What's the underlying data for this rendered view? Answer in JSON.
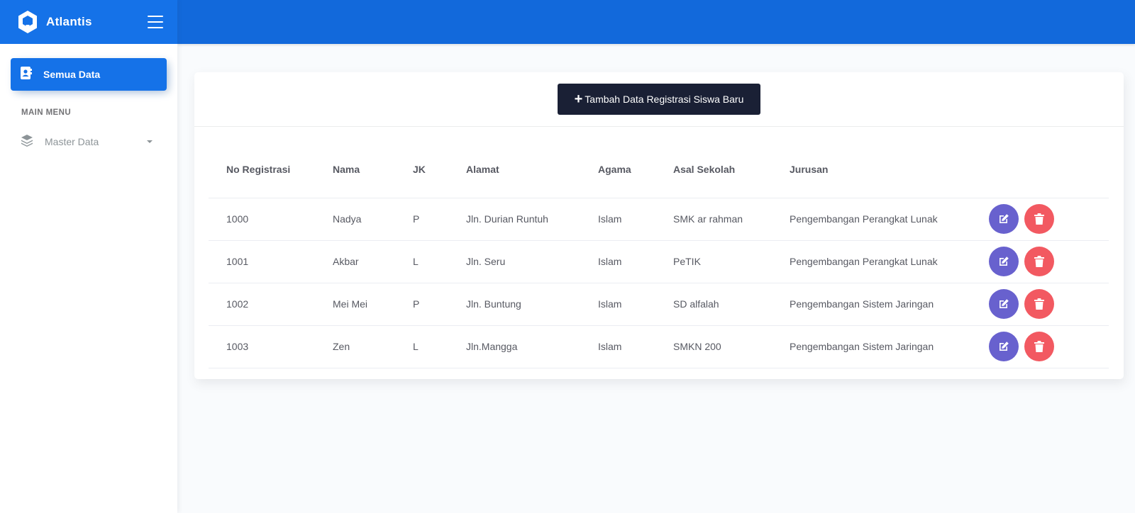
{
  "app": {
    "brand": "Atlantis"
  },
  "sidebar": {
    "active_item": {
      "label": "Semua Data",
      "icon": "contact-card-icon"
    },
    "section_title": "MAIN MENU",
    "items": [
      {
        "label": "Master Data",
        "icon": "layers-icon"
      }
    ]
  },
  "toolbar": {
    "add_label": "Tambah Data Registrasi Siswa Baru"
  },
  "table": {
    "headers": [
      "No Registrasi",
      "Nama",
      "JK",
      "Alamat",
      "Agama",
      "Asal Sekolah",
      "Jurusan"
    ],
    "rows": [
      [
        "1000",
        "Nadya",
        "P",
        "Jln. Durian Runtuh",
        "Islam",
        "SMK ar rahman",
        "Pengembangan Perangkat Lunak"
      ],
      [
        "1001",
        "Akbar",
        "L",
        "Jln. Seru",
        "Islam",
        "PeTIK",
        "Pengembangan Perangkat Lunak"
      ],
      [
        "1002",
        "Mei Mei",
        "P",
        "Jln. Buntung",
        "Islam",
        "SD alfalah",
        "Pengembangan Sistem Jaringan"
      ],
      [
        "1003",
        "Zen",
        "L",
        "Jln.Mangga",
        "Islam",
        "SMKN 200",
        "Pengembangan Sistem Jaringan"
      ]
    ]
  },
  "colors": {
    "primary": "#1572e8",
    "header": "#1269db",
    "dark": "#1a2035",
    "edit": "#6861ce",
    "delete": "#f25961"
  }
}
